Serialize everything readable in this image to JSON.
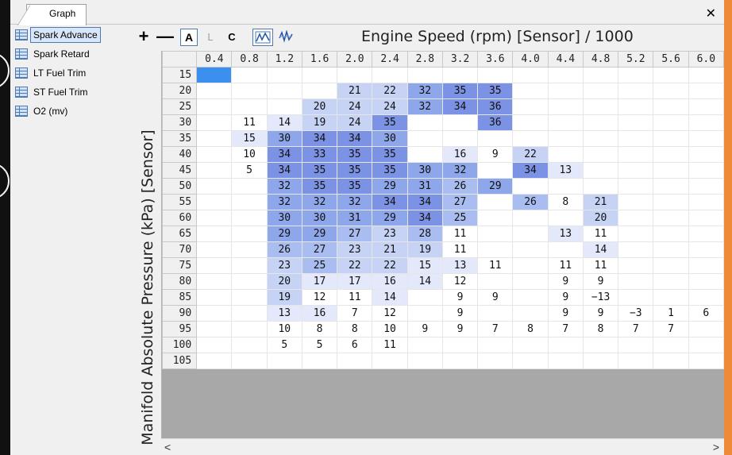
{
  "tabs": [
    {
      "label": "Graph"
    }
  ],
  "close_label": "✕",
  "sidebar": {
    "items": [
      {
        "label": "Spark Advance",
        "selected": true
      },
      {
        "label": "Spark Retard"
      },
      {
        "label": "LT Fuel Trim"
      },
      {
        "label": "ST Fuel Trim"
      },
      {
        "label": "O2 (mv)"
      }
    ]
  },
  "toolbar": {
    "plus": "+",
    "minus": "—",
    "a": "A",
    "l": "L",
    "c": "C",
    "graph_icon_1": "line-graph-icon",
    "graph_icon_2": "waveform-icon"
  },
  "x_axis_title": "Engine Speed (rpm) [Sensor] / 1000",
  "y_axis_title": "Manifold Absolute Pressure (kPa) [Sensor]",
  "columns": [
    "0.4",
    "0.8",
    "1.2",
    "1.6",
    "2.0",
    "2.4",
    "2.8",
    "3.2",
    "3.6",
    "4.0",
    "4.4",
    "4.8",
    "5.2",
    "5.6",
    "6.0"
  ],
  "rows": [
    {
      "label": "15",
      "cells": [
        "",
        "",
        "",
        "",
        "",
        "",
        "",
        "",
        "",
        "",
        "",
        "",
        "",
        "",
        ""
      ]
    },
    {
      "label": "20",
      "cells": [
        "",
        "",
        "",
        "",
        "21",
        "22",
        "32",
        "35",
        "35",
        "",
        "",
        "",
        "",
        "",
        ""
      ]
    },
    {
      "label": "25",
      "cells": [
        "",
        "",
        "",
        "20",
        "24",
        "24",
        "32",
        "34",
        "36",
        "",
        "",
        "",
        "",
        "",
        ""
      ]
    },
    {
      "label": "30",
      "cells": [
        "",
        "11",
        "14",
        "19",
        "24",
        "35",
        "",
        "",
        "36",
        "",
        "",
        "",
        "",
        "",
        ""
      ]
    },
    {
      "label": "35",
      "cells": [
        "",
        "15",
        "30",
        "34",
        "34",
        "30",
        "",
        "",
        "",
        "",
        "",
        "",
        "",
        "",
        ""
      ]
    },
    {
      "label": "40",
      "cells": [
        "",
        "10",
        "34",
        "33",
        "35",
        "35",
        "",
        "16",
        "9",
        "22",
        "",
        "",
        "",
        "",
        ""
      ]
    },
    {
      "label": "45",
      "cells": [
        "",
        "5",
        "34",
        "35",
        "35",
        "35",
        "30",
        "32",
        "",
        "34",
        "13",
        "",
        "",
        "",
        ""
      ]
    },
    {
      "label": "50",
      "cells": [
        "",
        "",
        "32",
        "35",
        "35",
        "29",
        "31",
        "26",
        "29",
        "",
        "",
        "",
        "",
        "",
        ""
      ]
    },
    {
      "label": "55",
      "cells": [
        "",
        "",
        "32",
        "32",
        "32",
        "34",
        "34",
        "27",
        "",
        "26",
        "8",
        "21",
        "",
        "",
        ""
      ]
    },
    {
      "label": "60",
      "cells": [
        "",
        "",
        "30",
        "30",
        "31",
        "29",
        "34",
        "25",
        "",
        "",
        "",
        "20",
        "",
        "",
        ""
      ]
    },
    {
      "label": "65",
      "cells": [
        "",
        "",
        "29",
        "29",
        "27",
        "23",
        "28",
        "11",
        "",
        "",
        "13",
        "11",
        "",
        "",
        ""
      ]
    },
    {
      "label": "70",
      "cells": [
        "",
        "",
        "26",
        "27",
        "23",
        "21",
        "19",
        "11",
        "",
        "",
        "",
        "14",
        "",
        "",
        ""
      ]
    },
    {
      "label": "75",
      "cells": [
        "",
        "",
        "23",
        "25",
        "22",
        "22",
        "15",
        "13",
        "11",
        "",
        "11",
        "11",
        "",
        "",
        ""
      ]
    },
    {
      "label": "80",
      "cells": [
        "",
        "",
        "20",
        "17",
        "17",
        "16",
        "14",
        "12",
        "",
        "",
        "9",
        "9",
        "",
        "",
        ""
      ]
    },
    {
      "label": "85",
      "cells": [
        "",
        "",
        "19",
        "12",
        "11",
        "14",
        "",
        "9",
        "9",
        "",
        "9",
        "−13",
        "",
        "",
        ""
      ]
    },
    {
      "label": "90",
      "cells": [
        "",
        "",
        "13",
        "16",
        "7",
        "12",
        "",
        "9",
        "",
        "",
        "9",
        "9",
        "−3",
        "1",
        "6"
      ]
    },
    {
      "label": "95",
      "cells": [
        "",
        "",
        "10",
        "8",
        "8",
        "10",
        "9",
        "9",
        "7",
        "8",
        "7",
        "8",
        "7",
        "7",
        ""
      ]
    },
    {
      "label": "100",
      "cells": [
        "",
        "",
        "5",
        "5",
        "6",
        "11",
        "",
        "",
        "",
        "",
        "",
        "",
        "",
        "",
        ""
      ]
    },
    {
      "label": "105",
      "cells": [
        "",
        "",
        "",
        "",
        "",
        "",
        "",
        "",
        "",
        "",
        "",
        "",
        "",
        "",
        ""
      ]
    }
  ],
  "scroll_left": "<",
  "scroll_right": ">"
}
